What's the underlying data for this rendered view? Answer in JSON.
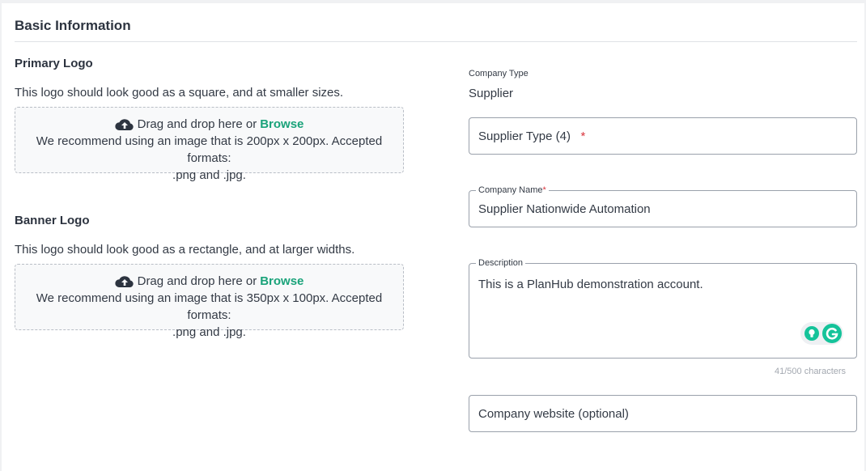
{
  "section": {
    "title": "Basic Information"
  },
  "primary_logo": {
    "heading": "Primary Logo",
    "description": "This logo should look good as a square, and at smaller sizes.",
    "drop_text": "Drag and drop here or",
    "browse_label": "Browse",
    "recommend_line1": "We recommend using an image that is 200px x 200px. Accepted formats:",
    "recommend_line2": ".png and .jpg."
  },
  "banner_logo": {
    "heading": "Banner Logo",
    "description": "This logo should look good as a rectangle, and at larger widths.",
    "drop_text": "Drag and drop here or",
    "browse_label": "Browse",
    "recommend_line1": "We recommend using an image that is 350px x 100px. Accepted formats:",
    "recommend_line2": ".png and .jpg."
  },
  "company_type": {
    "label": "Company Type",
    "value": "Supplier"
  },
  "supplier_type": {
    "value": "Supplier Type (4)",
    "required_mark": "*"
  },
  "company_name": {
    "label": "Company Name",
    "required_mark": "*",
    "value": "Supplier Nationwide Automation"
  },
  "description": {
    "label": "Description",
    "value": "This is a PlanHub demonstration account.",
    "counter": "41/500 characters"
  },
  "website": {
    "placeholder": "Company website (optional)"
  },
  "colors": {
    "accent": "#1aa37a",
    "required": "#d9363e",
    "grammarly": "#15c39a"
  },
  "icons": {
    "upload": "cloud-upload-icon",
    "bulb": "lightbulb-icon",
    "grammarly": "grammarly-icon"
  }
}
